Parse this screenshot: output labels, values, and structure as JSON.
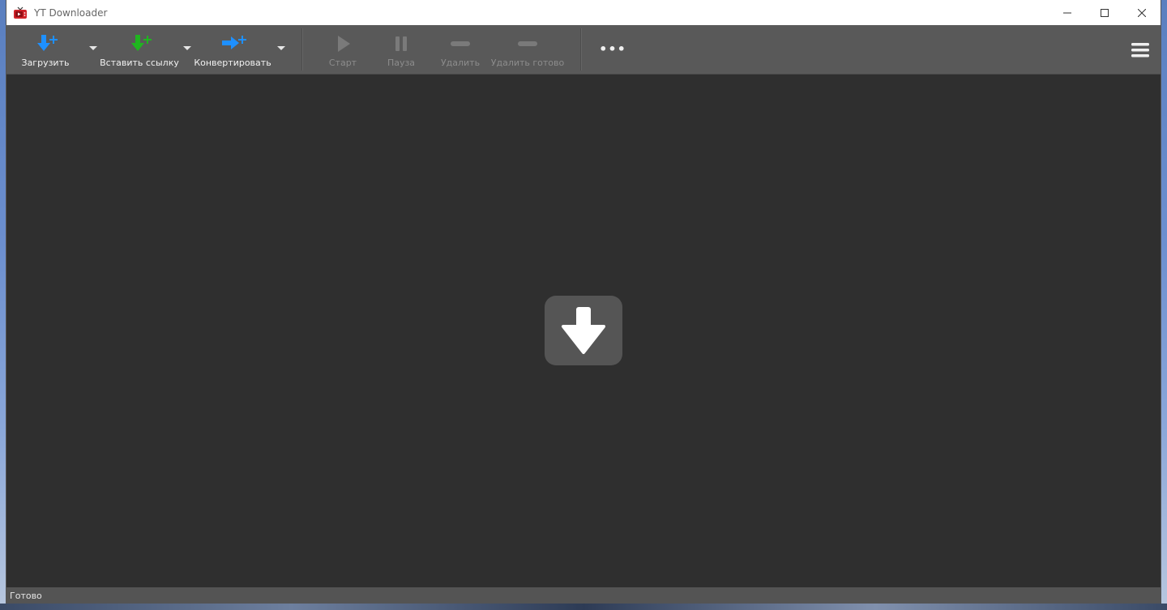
{
  "window": {
    "title": "YT Downloader"
  },
  "toolbar": {
    "download_label": "Загрузить",
    "paste_link_label": "Вставить ссылку",
    "convert_label": "Конвертировать",
    "start_label": "Старт",
    "pause_label": "Пауза",
    "delete_label": "Удалить",
    "delete_done_label": "Удалить готово",
    "more_label": "•••"
  },
  "status": {
    "text": "Готово"
  },
  "colors": {
    "download_accent": "#1e90ff",
    "paste_accent": "#1fb51f",
    "convert_accent": "#1e90ff",
    "app_icon": "#d0232a"
  },
  "icons": {
    "app": "tv-icon",
    "download": "arrow-down-plus-icon",
    "paste": "arrow-down-plus-icon",
    "convert": "arrow-right-plus-icon",
    "start": "play-icon",
    "pause": "pause-icon",
    "delete": "minus-icon",
    "delete_done": "minus-icon",
    "more": "more-dots-icon",
    "menu": "hamburger-icon",
    "drop": "download-arrow-icon"
  }
}
